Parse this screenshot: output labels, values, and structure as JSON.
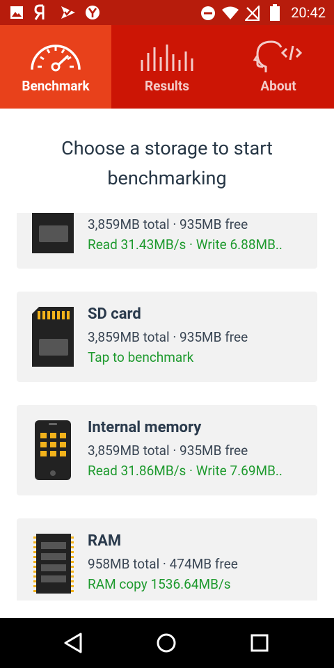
{
  "status_bar": {
    "time": "20:42",
    "left_icons": [
      "image-icon",
      "yandex-icon",
      "check-flag-icon",
      "yandex-circle-icon"
    ],
    "right_icons": [
      "do-not-disturb-icon",
      "wifi-icon",
      "no-signal-icon",
      "battery-icon"
    ]
  },
  "tabs": [
    {
      "label": "Benchmark",
      "icon": "speedometer-icon",
      "active": true
    },
    {
      "label": "Results",
      "icon": "bars-icon",
      "active": false
    },
    {
      "label": "About",
      "icon": "head-code-icon",
      "active": false
    }
  ],
  "heading": {
    "line1": "Choose a storage to start",
    "line2": "benchmarking"
  },
  "storage_items": [
    {
      "name": "",
      "info": "3,859MB total · 935MB free",
      "status": "Read 31.43MB/s · Write 6.88MB..",
      "icon": "sd-card-icon"
    },
    {
      "name": "SD card",
      "info": "3,859MB total · 935MB free",
      "status": "Tap to benchmark",
      "icon": "sd-card-icon"
    },
    {
      "name": "Internal memory",
      "info": "3,859MB total · 935MB free",
      "status": "Read 31.86MB/s · Write 7.69MB..",
      "icon": "phone-chip-icon"
    },
    {
      "name": "RAM",
      "info": "958MB total · 474MB free",
      "status": "RAM copy 1536.64MB/s",
      "icon": "ram-stick-icon"
    }
  ],
  "colors": {
    "status_bar": "#b71c0c",
    "tab_bar": "#cc1505",
    "tab_active": "#e8411b",
    "heading_text": "#263645",
    "card_bg": "#f2f2f2",
    "status_green": "#1e9a2e"
  },
  "nav_bar": {
    "buttons": [
      "back-icon",
      "home-icon",
      "recents-icon"
    ]
  }
}
